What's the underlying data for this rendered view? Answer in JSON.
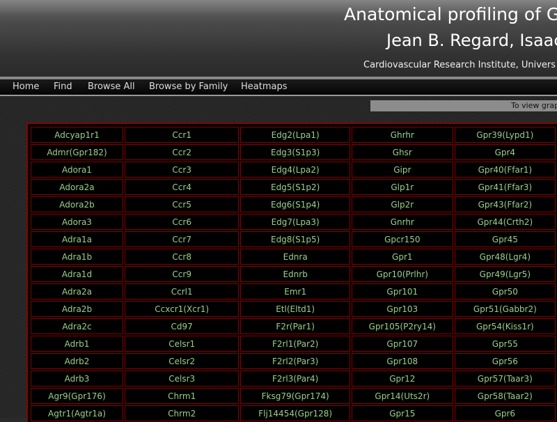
{
  "header": {
    "title_line1": "Anatomical profiling of G p",
    "title_line2": "Jean B. Regard, Isaac",
    "subtitle": "Cardiovascular Research Institute, Univers"
  },
  "nav": {
    "items": [
      "Home",
      "Find",
      "Browse All",
      "Browse by Family",
      "Heatmaps"
    ]
  },
  "notice": "To view graph",
  "genes": [
    [
      "Adcyap1r1",
      "Ccr1",
      "Edg2(Lpa1)",
      "Ghrhr",
      "Gpr39(Lypd1)"
    ],
    [
      "Admr(Gpr182)",
      "Ccr2",
      "Edg3(S1p3)",
      "Ghsr",
      "Gpr4"
    ],
    [
      "Adora1",
      "Ccr3",
      "Edg4(Lpa2)",
      "Gipr",
      "Gpr40(Ffar1)"
    ],
    [
      "Adora2a",
      "Ccr4",
      "Edg5(S1p2)",
      "Glp1r",
      "Gpr41(Ffar3)"
    ],
    [
      "Adora2b",
      "Ccr5",
      "Edg6(S1p4)",
      "Glp2r",
      "Gpr43(Ffar2)"
    ],
    [
      "Adora3",
      "Ccr6",
      "Edg7(Lpa3)",
      "Gnrhr",
      "Gpr44(Crth2)"
    ],
    [
      "Adra1a",
      "Ccr7",
      "Edg8(S1p5)",
      "Gpcr150",
      "Gpr45"
    ],
    [
      "Adra1b",
      "Ccr8",
      "Ednra",
      "Gpr1",
      "Gpr48(Lgr4)"
    ],
    [
      "Adra1d",
      "Ccr9",
      "Ednrb",
      "Gpr10(Prlhr)",
      "Gpr49(Lgr5)"
    ],
    [
      "Adra2a",
      "Ccrl1",
      "Emr1",
      "Gpr101",
      "Gpr50"
    ],
    [
      "Adra2b",
      "Ccxcr1(Xcr1)",
      "Etl(Eltd1)",
      "Gpr103",
      "Gpr51(Gabbr2)"
    ],
    [
      "Adra2c",
      "Cd97",
      "F2r(Par1)",
      "Gpr105(P2ry14)",
      "Gpr54(Kiss1r)"
    ],
    [
      "Adrb1",
      "Celsr1",
      "F2rl1(Par2)",
      "Gpr107",
      "Gpr55"
    ],
    [
      "Adrb2",
      "Celsr2",
      "F2rl2(Par3)",
      "Gpr108",
      "Gpr56"
    ],
    [
      "Adrb3",
      "Celsr3",
      "F2rl3(Par4)",
      "Gpr12",
      "Gpr57(Taar3)"
    ],
    [
      "Agr9(Gpr176)",
      "Chrm1",
      "Fksg79(Gpr174)",
      "Gpr14(Uts2r)",
      "Gpr58(Taar2)"
    ],
    [
      "Agtr1(Agtr1a)",
      "Chrm2",
      "Flj14454(Gpr128)",
      "Gpr15",
      "Gpr6"
    ]
  ]
}
